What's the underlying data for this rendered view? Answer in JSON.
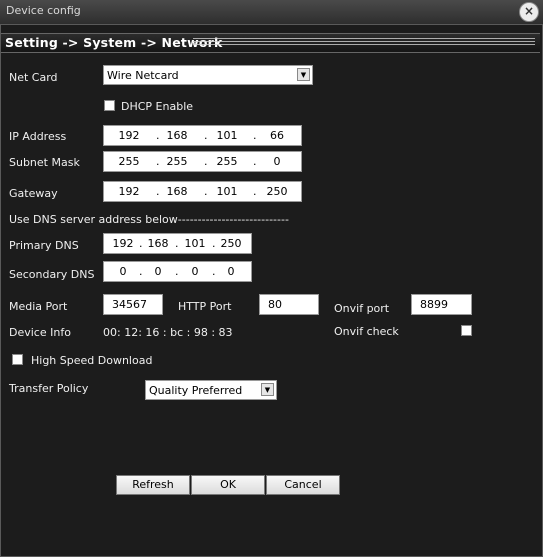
{
  "window": {
    "title": "Device config"
  },
  "header": {
    "path": "Setting -> System -> Network"
  },
  "net_card": {
    "label": "Net Card",
    "value": "Wire Netcard"
  },
  "dhcp": {
    "label": "DHCP Enable",
    "checked": false
  },
  "ip_address": {
    "label": "IP Address",
    "octets": [
      "192",
      "168",
      "101",
      "66"
    ]
  },
  "subnet_mask": {
    "label": "Subnet Mask",
    "octets": [
      "255",
      "255",
      "255",
      "0"
    ]
  },
  "gateway": {
    "label": "Gateway",
    "octets": [
      "192",
      "168",
      "101",
      "250"
    ]
  },
  "dns_section": {
    "label": "Use DNS server address below----------------------------"
  },
  "primary_dns": {
    "label": "Primary DNS",
    "octets": [
      "192",
      "168",
      "101",
      "250"
    ]
  },
  "secondary_dns": {
    "label": "Secondary DNS",
    "octets": [
      "0",
      "0",
      "0",
      "0"
    ]
  },
  "media_port": {
    "label": "Media Port",
    "value": "34567"
  },
  "http_port": {
    "label": "HTTP Port",
    "value": "80"
  },
  "onvif_port": {
    "label": "Onvif port",
    "value": "8899"
  },
  "device_info": {
    "label": "Device Info",
    "value": "00: 12: 16 : bc : 98 : 83"
  },
  "onvif_check": {
    "label": "Onvif check",
    "checked": false
  },
  "high_speed": {
    "label": "High Speed Download",
    "checked": false
  },
  "transfer_policy": {
    "label": "Transfer Policy",
    "value": "Quality Preferred"
  },
  "buttons": {
    "refresh": "Refresh",
    "ok": "OK",
    "cancel": "Cancel"
  }
}
